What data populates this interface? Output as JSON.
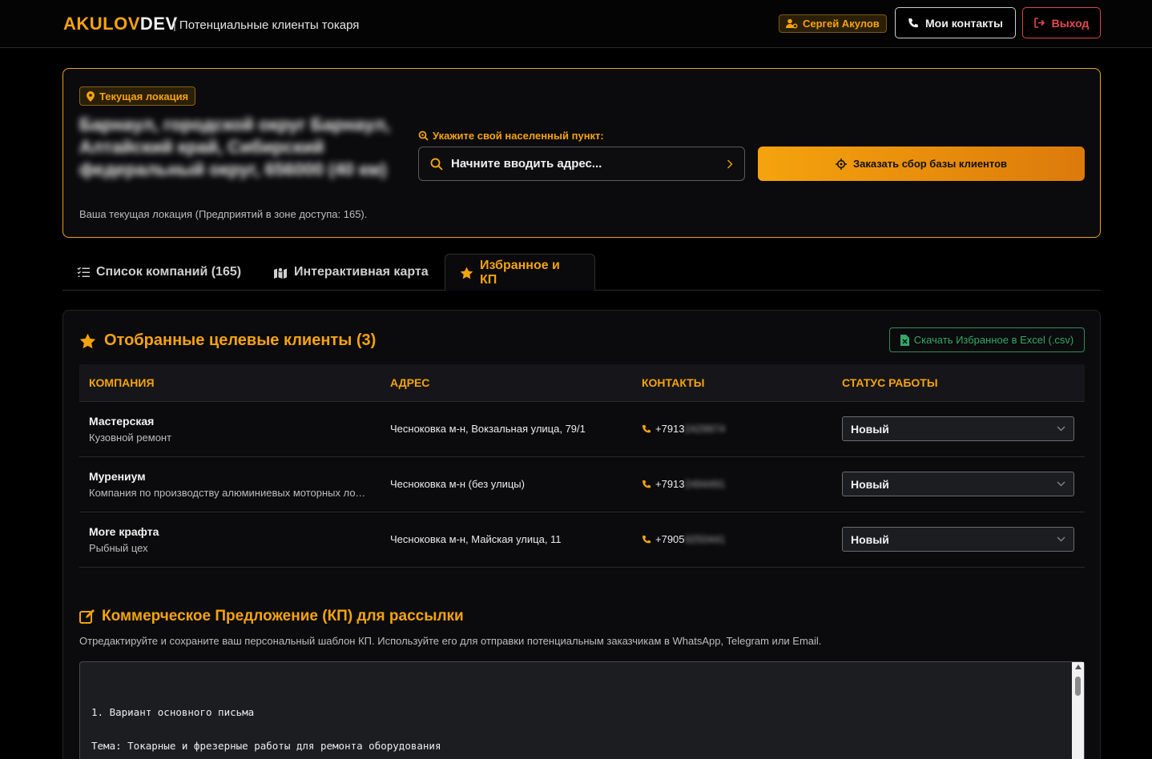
{
  "header": {
    "brand_a": "AKULOV",
    "brand_b": "DEV",
    "separator": "|",
    "subtitle": "Потенциальные клиенты токаря",
    "user_name": "Сергей Акулов",
    "contacts_label": "Мои контакты",
    "logout_label": "Выход"
  },
  "location": {
    "badge": "Текущая локация",
    "address": "Барнаул, городской округ Барнаул, Алтайский край, Сибирский федеральный округ, 656000 (40 км)",
    "caption": "Ваша текущая локация (Предприятий в зоне доступа: 165).",
    "city_label": "Укажите свой населенный пункт:",
    "city_placeholder": "Начните вводить адрес...",
    "order_button": "Заказать сбор базы клиентов"
  },
  "tabs": [
    {
      "label": "Список компаний (165)"
    },
    {
      "label": "Интерактивная карта"
    },
    {
      "label": "Избранное и КП"
    }
  ],
  "favorites": {
    "title": "Отобранные целевые клиенты (3)",
    "csv_button": "Скачать Избранное в Excel (.csv)",
    "columns": [
      "КОМПАНИЯ",
      "АДРЕС",
      "КОНТАКТЫ",
      "СТАТУС РАБОТЫ"
    ],
    "rows": [
      {
        "name": "Мастерская",
        "desc": "Кузовной ремонт",
        "address": "Чесноковка м-н, Вокзальная улица, 79/1",
        "phone_visible": "+7913",
        "phone_hidden": "2429974",
        "status": "Новый"
      },
      {
        "name": "Мурениум",
        "desc": "Компания по производству алюминиевых моторных лодок",
        "address": "Чесноковка м-н (без улицы)",
        "phone_visible": "+7913",
        "phone_hidden": "2494491",
        "status": "Новый"
      },
      {
        "name": "More крафта",
        "desc": "Рыбный цех",
        "address": "Чесноковка м-н, Майская улица, 11",
        "phone_visible": "+7905",
        "phone_hidden": "9250441",
        "status": "Новый"
      }
    ]
  },
  "kp": {
    "title": "Коммерческое Предложение (КП) для рассылки",
    "description": "Отредактируйте и сохраните ваш персональный шаблон КП. Используйте его для отправки потенциальным заказчикам в WhatsApp, Telegram или Email.",
    "text": "1. Вариант основного письма\n\nТема: Токарные и фрезерные работы для ремонта оборудования\n\nЗдравствуйте, [Имя Отчество]!"
  },
  "colors": {
    "accent": "#f5a30d",
    "danger": "#e44a50",
    "success": "#33a868",
    "background": "#000000"
  }
}
